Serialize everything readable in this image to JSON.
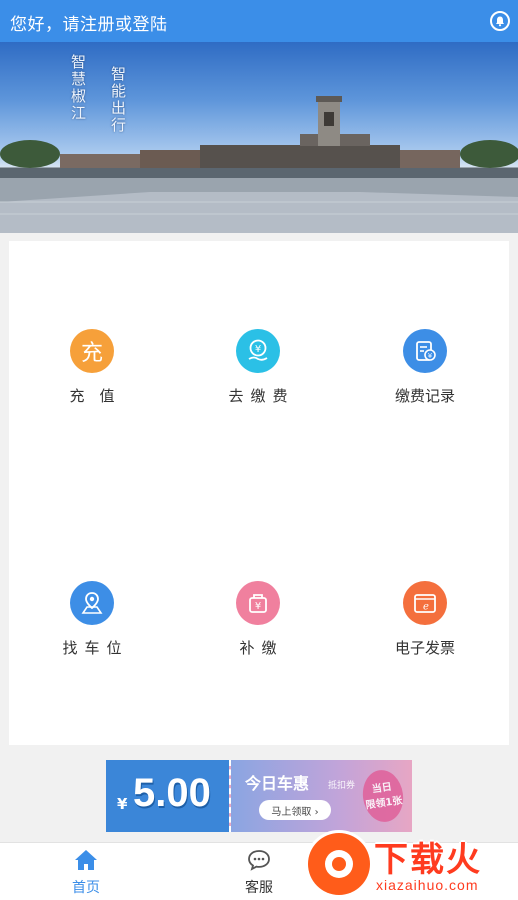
{
  "header": {
    "title": "您好，请注册或登陆",
    "bell_icon": "bell-icon"
  },
  "banner": {
    "poem_right": "智慧椒江",
    "poem_left": "智能出行"
  },
  "menu": {
    "items": [
      {
        "label": "充　值",
        "icon": "recharge-icon",
        "color": "#f6a03a",
        "glyph": "充"
      },
      {
        "label": "去缴费",
        "icon": "pay-icon",
        "color": "#2bc0e6",
        "glyph": "¥"
      },
      {
        "label": "缴费记录",
        "icon": "payment-record-icon",
        "color": "#3d8ee6",
        "glyph": "¥"
      },
      {
        "label": "找车位",
        "icon": "find-parking-icon",
        "color": "#3d8ee6",
        "glyph": ""
      },
      {
        "label": "补缴",
        "icon": "supplementary-pay-icon",
        "color": "#f0809e",
        "glyph": "¥"
      },
      {
        "label": "电子发票",
        "icon": "e-invoice-icon",
        "color": "#f46f3d",
        "glyph": "e"
      }
    ]
  },
  "promo": {
    "currency": "¥",
    "amount": "5.00",
    "title": "今日车惠",
    "subtitle": "抵扣券",
    "button": "马上领取 ›",
    "seal_line1": "当日",
    "seal_line2": "限领1张"
  },
  "tabbar": {
    "tabs": [
      {
        "label": "首页",
        "icon": "home-icon",
        "active": true
      },
      {
        "label": "客服",
        "icon": "customer-service-icon",
        "active": false
      }
    ],
    "active_color": "#3b8ee8",
    "inactive_color": "#333333"
  },
  "watermark": {
    "brand": "下载火",
    "domain": "xiazaihuo.com"
  }
}
